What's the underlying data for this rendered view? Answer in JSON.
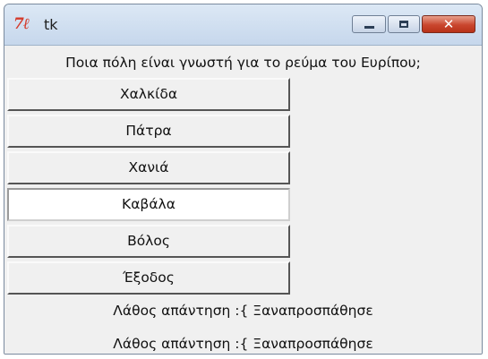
{
  "window": {
    "title": "tk",
    "icon": "tk-feather-icon",
    "controls": [
      "minimize-icon",
      "maximize-icon",
      "close-icon"
    ]
  },
  "question": "Ποια πόλη είναι γνωστή για το ρεύμα του Ευρίπου;",
  "answers": [
    {
      "label": "Χαλκίδα"
    },
    {
      "label": "Πάτρα"
    },
    {
      "label": "Χανιά"
    },
    {
      "label": "Καβάλα",
      "active": true
    },
    {
      "label": "Βόλος"
    },
    {
      "label": "Έξοδος"
    }
  ],
  "messages": [
    "Λάθος απάντηση :{ Ξαναπροσπάθησε",
    "Λάθος απάντηση :{ Ξαναπροσπάθησε"
  ],
  "colors": {
    "window_bg": "#f0f0f0",
    "titlebar": "#c6d7ec",
    "close_button": "#c9462e",
    "icon_red": "#d43a2a"
  }
}
